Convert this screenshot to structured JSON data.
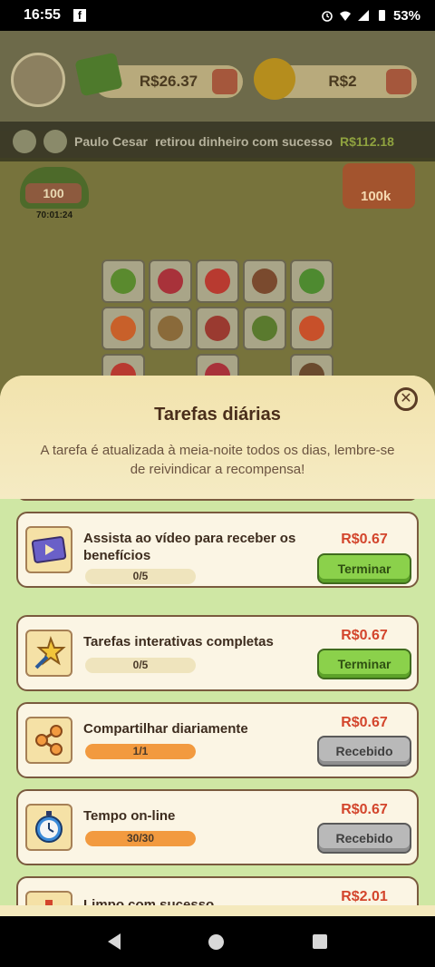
{
  "status_bar": {
    "time": "16:55",
    "battery": "53%",
    "app_icon": "facebook-icon"
  },
  "hud": {
    "money": "R$26.37",
    "coins": "R$2"
  },
  "ticker": {
    "user": "Paulo Cesar",
    "message": "retirou dinheiro com sucesso",
    "amount": "R$112.18"
  },
  "game": {
    "left_tag": "100",
    "timer": "70:01:24",
    "right_tag": "100k"
  },
  "modal": {
    "title": "Tarefas diárias",
    "description": "A tarefa é atualizada à meia-noite todos os dias, lembre-se de reivindicar a recompensa!",
    "tasks": [
      {
        "icon": "video-icon",
        "title": "Assista ao vídeo para receber os benefícios",
        "progress_text": "0/5",
        "progress": 0,
        "reward": "R$0.67",
        "button": "Terminar",
        "state": "done"
      },
      {
        "icon": "star-wand-icon",
        "title": "Tarefas interativas completas",
        "progress_text": "0/5",
        "progress": 0,
        "reward": "R$0.67",
        "button": "Terminar",
        "state": "done"
      },
      {
        "icon": "share-icon",
        "title": "Compartilhar diariamente",
        "progress_text": "1/1",
        "progress": 1,
        "reward": "R$0.67",
        "button": "Recebido",
        "state": "received"
      },
      {
        "icon": "stopwatch-icon",
        "title": "Tempo on-line",
        "progress_text": "30/30",
        "progress": 1,
        "reward": "R$0.67",
        "button": "Recebido",
        "state": "received"
      },
      {
        "icon": "broom-icon",
        "title": "Limpo com sucesso",
        "reward": "R$2.01"
      }
    ]
  },
  "colors": {
    "reward": "#d3452c",
    "done_button": "#8bd14b",
    "received_button": "#b9b9b9",
    "progress_fill": "#f29a3f"
  }
}
